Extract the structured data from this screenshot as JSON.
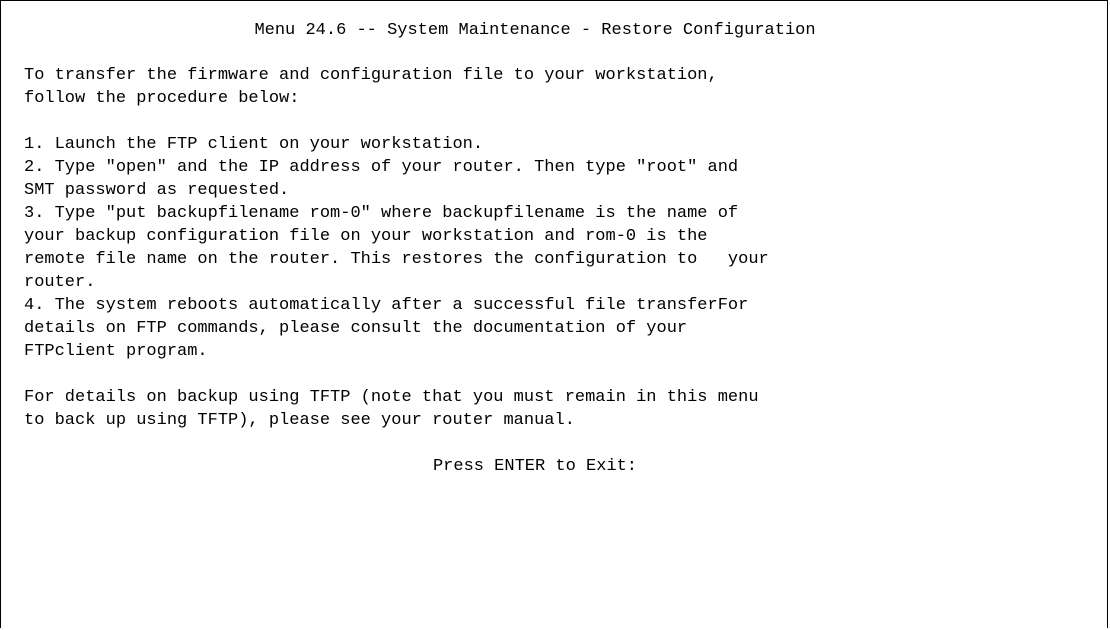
{
  "screen": {
    "title": "Menu 24.6 -- System Maintenance - Restore Configuration",
    "intro": [
      "To transfer the firmware and configuration file to your workstation,",
      "follow the procedure below:"
    ],
    "steps": [
      "1. Launch the FTP client on your workstation.",
      "2. Type \"open\" and the IP address of your router. Then type \"root\" and",
      "SMT password as requested.",
      "3. Type \"put backupfilename rom-0\" where backupfilename is the name of",
      "your backup configuration file on your workstation and rom-0 is the",
      "remote file name on the router. This restores the configuration to   your",
      "router.",
      "4. The system reboots automatically after a successful file transferFor",
      "details on FTP commands, please consult the documentation of your",
      "FTPclient program."
    ],
    "tftp_note": [
      "For details on backup using TFTP (note that you must remain in this menu",
      "to back up using TFTP), please see your router manual."
    ],
    "prompt": "Press ENTER to Exit:"
  }
}
